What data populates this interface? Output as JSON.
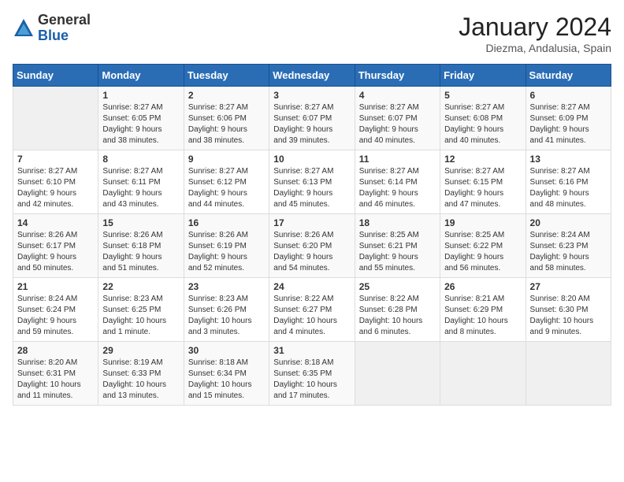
{
  "header": {
    "logo_general": "General",
    "logo_blue": "Blue",
    "month_year": "January 2024",
    "location": "Diezma, Andalusia, Spain"
  },
  "weekdays": [
    "Sunday",
    "Monday",
    "Tuesday",
    "Wednesday",
    "Thursday",
    "Friday",
    "Saturday"
  ],
  "weeks": [
    [
      {
        "day": "",
        "info": ""
      },
      {
        "day": "1",
        "info": "Sunrise: 8:27 AM\nSunset: 6:05 PM\nDaylight: 9 hours\nand 38 minutes."
      },
      {
        "day": "2",
        "info": "Sunrise: 8:27 AM\nSunset: 6:06 PM\nDaylight: 9 hours\nand 38 minutes."
      },
      {
        "day": "3",
        "info": "Sunrise: 8:27 AM\nSunset: 6:07 PM\nDaylight: 9 hours\nand 39 minutes."
      },
      {
        "day": "4",
        "info": "Sunrise: 8:27 AM\nSunset: 6:07 PM\nDaylight: 9 hours\nand 40 minutes."
      },
      {
        "day": "5",
        "info": "Sunrise: 8:27 AM\nSunset: 6:08 PM\nDaylight: 9 hours\nand 40 minutes."
      },
      {
        "day": "6",
        "info": "Sunrise: 8:27 AM\nSunset: 6:09 PM\nDaylight: 9 hours\nand 41 minutes."
      }
    ],
    [
      {
        "day": "7",
        "info": "Sunrise: 8:27 AM\nSunset: 6:10 PM\nDaylight: 9 hours\nand 42 minutes."
      },
      {
        "day": "8",
        "info": "Sunrise: 8:27 AM\nSunset: 6:11 PM\nDaylight: 9 hours\nand 43 minutes."
      },
      {
        "day": "9",
        "info": "Sunrise: 8:27 AM\nSunset: 6:12 PM\nDaylight: 9 hours\nand 44 minutes."
      },
      {
        "day": "10",
        "info": "Sunrise: 8:27 AM\nSunset: 6:13 PM\nDaylight: 9 hours\nand 45 minutes."
      },
      {
        "day": "11",
        "info": "Sunrise: 8:27 AM\nSunset: 6:14 PM\nDaylight: 9 hours\nand 46 minutes."
      },
      {
        "day": "12",
        "info": "Sunrise: 8:27 AM\nSunset: 6:15 PM\nDaylight: 9 hours\nand 47 minutes."
      },
      {
        "day": "13",
        "info": "Sunrise: 8:27 AM\nSunset: 6:16 PM\nDaylight: 9 hours\nand 48 minutes."
      }
    ],
    [
      {
        "day": "14",
        "info": "Sunrise: 8:26 AM\nSunset: 6:17 PM\nDaylight: 9 hours\nand 50 minutes."
      },
      {
        "day": "15",
        "info": "Sunrise: 8:26 AM\nSunset: 6:18 PM\nDaylight: 9 hours\nand 51 minutes."
      },
      {
        "day": "16",
        "info": "Sunrise: 8:26 AM\nSunset: 6:19 PM\nDaylight: 9 hours\nand 52 minutes."
      },
      {
        "day": "17",
        "info": "Sunrise: 8:26 AM\nSunset: 6:20 PM\nDaylight: 9 hours\nand 54 minutes."
      },
      {
        "day": "18",
        "info": "Sunrise: 8:25 AM\nSunset: 6:21 PM\nDaylight: 9 hours\nand 55 minutes."
      },
      {
        "day": "19",
        "info": "Sunrise: 8:25 AM\nSunset: 6:22 PM\nDaylight: 9 hours\nand 56 minutes."
      },
      {
        "day": "20",
        "info": "Sunrise: 8:24 AM\nSunset: 6:23 PM\nDaylight: 9 hours\nand 58 minutes."
      }
    ],
    [
      {
        "day": "21",
        "info": "Sunrise: 8:24 AM\nSunset: 6:24 PM\nDaylight: 9 hours\nand 59 minutes."
      },
      {
        "day": "22",
        "info": "Sunrise: 8:23 AM\nSunset: 6:25 PM\nDaylight: 10 hours\nand 1 minute."
      },
      {
        "day": "23",
        "info": "Sunrise: 8:23 AM\nSunset: 6:26 PM\nDaylight: 10 hours\nand 3 minutes."
      },
      {
        "day": "24",
        "info": "Sunrise: 8:22 AM\nSunset: 6:27 PM\nDaylight: 10 hours\nand 4 minutes."
      },
      {
        "day": "25",
        "info": "Sunrise: 8:22 AM\nSunset: 6:28 PM\nDaylight: 10 hours\nand 6 minutes."
      },
      {
        "day": "26",
        "info": "Sunrise: 8:21 AM\nSunset: 6:29 PM\nDaylight: 10 hours\nand 8 minutes."
      },
      {
        "day": "27",
        "info": "Sunrise: 8:20 AM\nSunset: 6:30 PM\nDaylight: 10 hours\nand 9 minutes."
      }
    ],
    [
      {
        "day": "28",
        "info": "Sunrise: 8:20 AM\nSunset: 6:31 PM\nDaylight: 10 hours\nand 11 minutes."
      },
      {
        "day": "29",
        "info": "Sunrise: 8:19 AM\nSunset: 6:33 PM\nDaylight: 10 hours\nand 13 minutes."
      },
      {
        "day": "30",
        "info": "Sunrise: 8:18 AM\nSunset: 6:34 PM\nDaylight: 10 hours\nand 15 minutes."
      },
      {
        "day": "31",
        "info": "Sunrise: 8:18 AM\nSunset: 6:35 PM\nDaylight: 10 hours\nand 17 minutes."
      },
      {
        "day": "",
        "info": ""
      },
      {
        "day": "",
        "info": ""
      },
      {
        "day": "",
        "info": ""
      }
    ]
  ]
}
